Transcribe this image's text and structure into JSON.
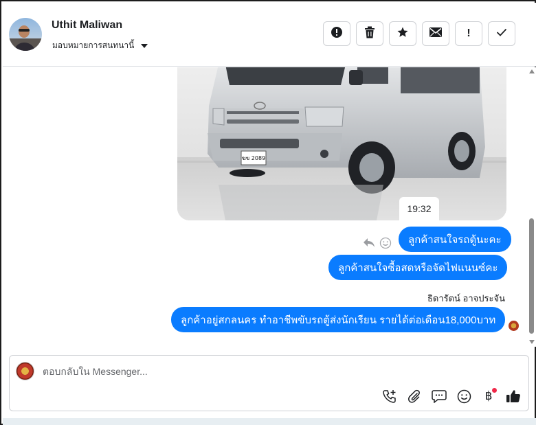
{
  "header": {
    "contact_name": "Uthit Maliwan",
    "assign_label": "มอบหมายการสนทนานี้",
    "actions": [
      {
        "name": "spam-button",
        "icon": "alert-circle-icon"
      },
      {
        "name": "delete-button",
        "icon": "trash-icon"
      },
      {
        "name": "star-button",
        "icon": "star-icon"
      },
      {
        "name": "mark-unread-button",
        "icon": "envelope-icon"
      },
      {
        "name": "follow-up-button",
        "icon": "exclamation-icon",
        "glyph": "!"
      },
      {
        "name": "mark-done-button",
        "icon": "check-icon"
      }
    ]
  },
  "thread": {
    "photo_alt": "รถตู้สีเงิน",
    "plate_text": "ฆข 2089",
    "timestamp": "19:32",
    "messages": [
      {
        "text": "ลูกค้าสนใจรถตู้นะคะ"
      },
      {
        "text": "ลูกค้าสนใจซื้อสดหรือจัดไฟแนนซ์คะ"
      },
      {
        "text": "ลูกค้าอยู่สกลนคร ทำอาชีพขับรถตู้ส่งนักเรียน รายได้ต่อเดือน18,000บาท"
      }
    ],
    "sender_name": "ธิดารัตน์ อาจประจัน"
  },
  "composer": {
    "placeholder": "ตอบกลับใน Messenger...",
    "value": "",
    "tools": [
      "phone-plus-icon",
      "paperclip-icon",
      "chat-bubble-icon",
      "emoji-icon",
      "baht-icon",
      "thumbs-up-icon"
    ],
    "baht_glyph": "฿"
  },
  "colors": {
    "bubble": "#0a7cff",
    "border": "#ced0d4",
    "notification_dot": "#f02849"
  }
}
